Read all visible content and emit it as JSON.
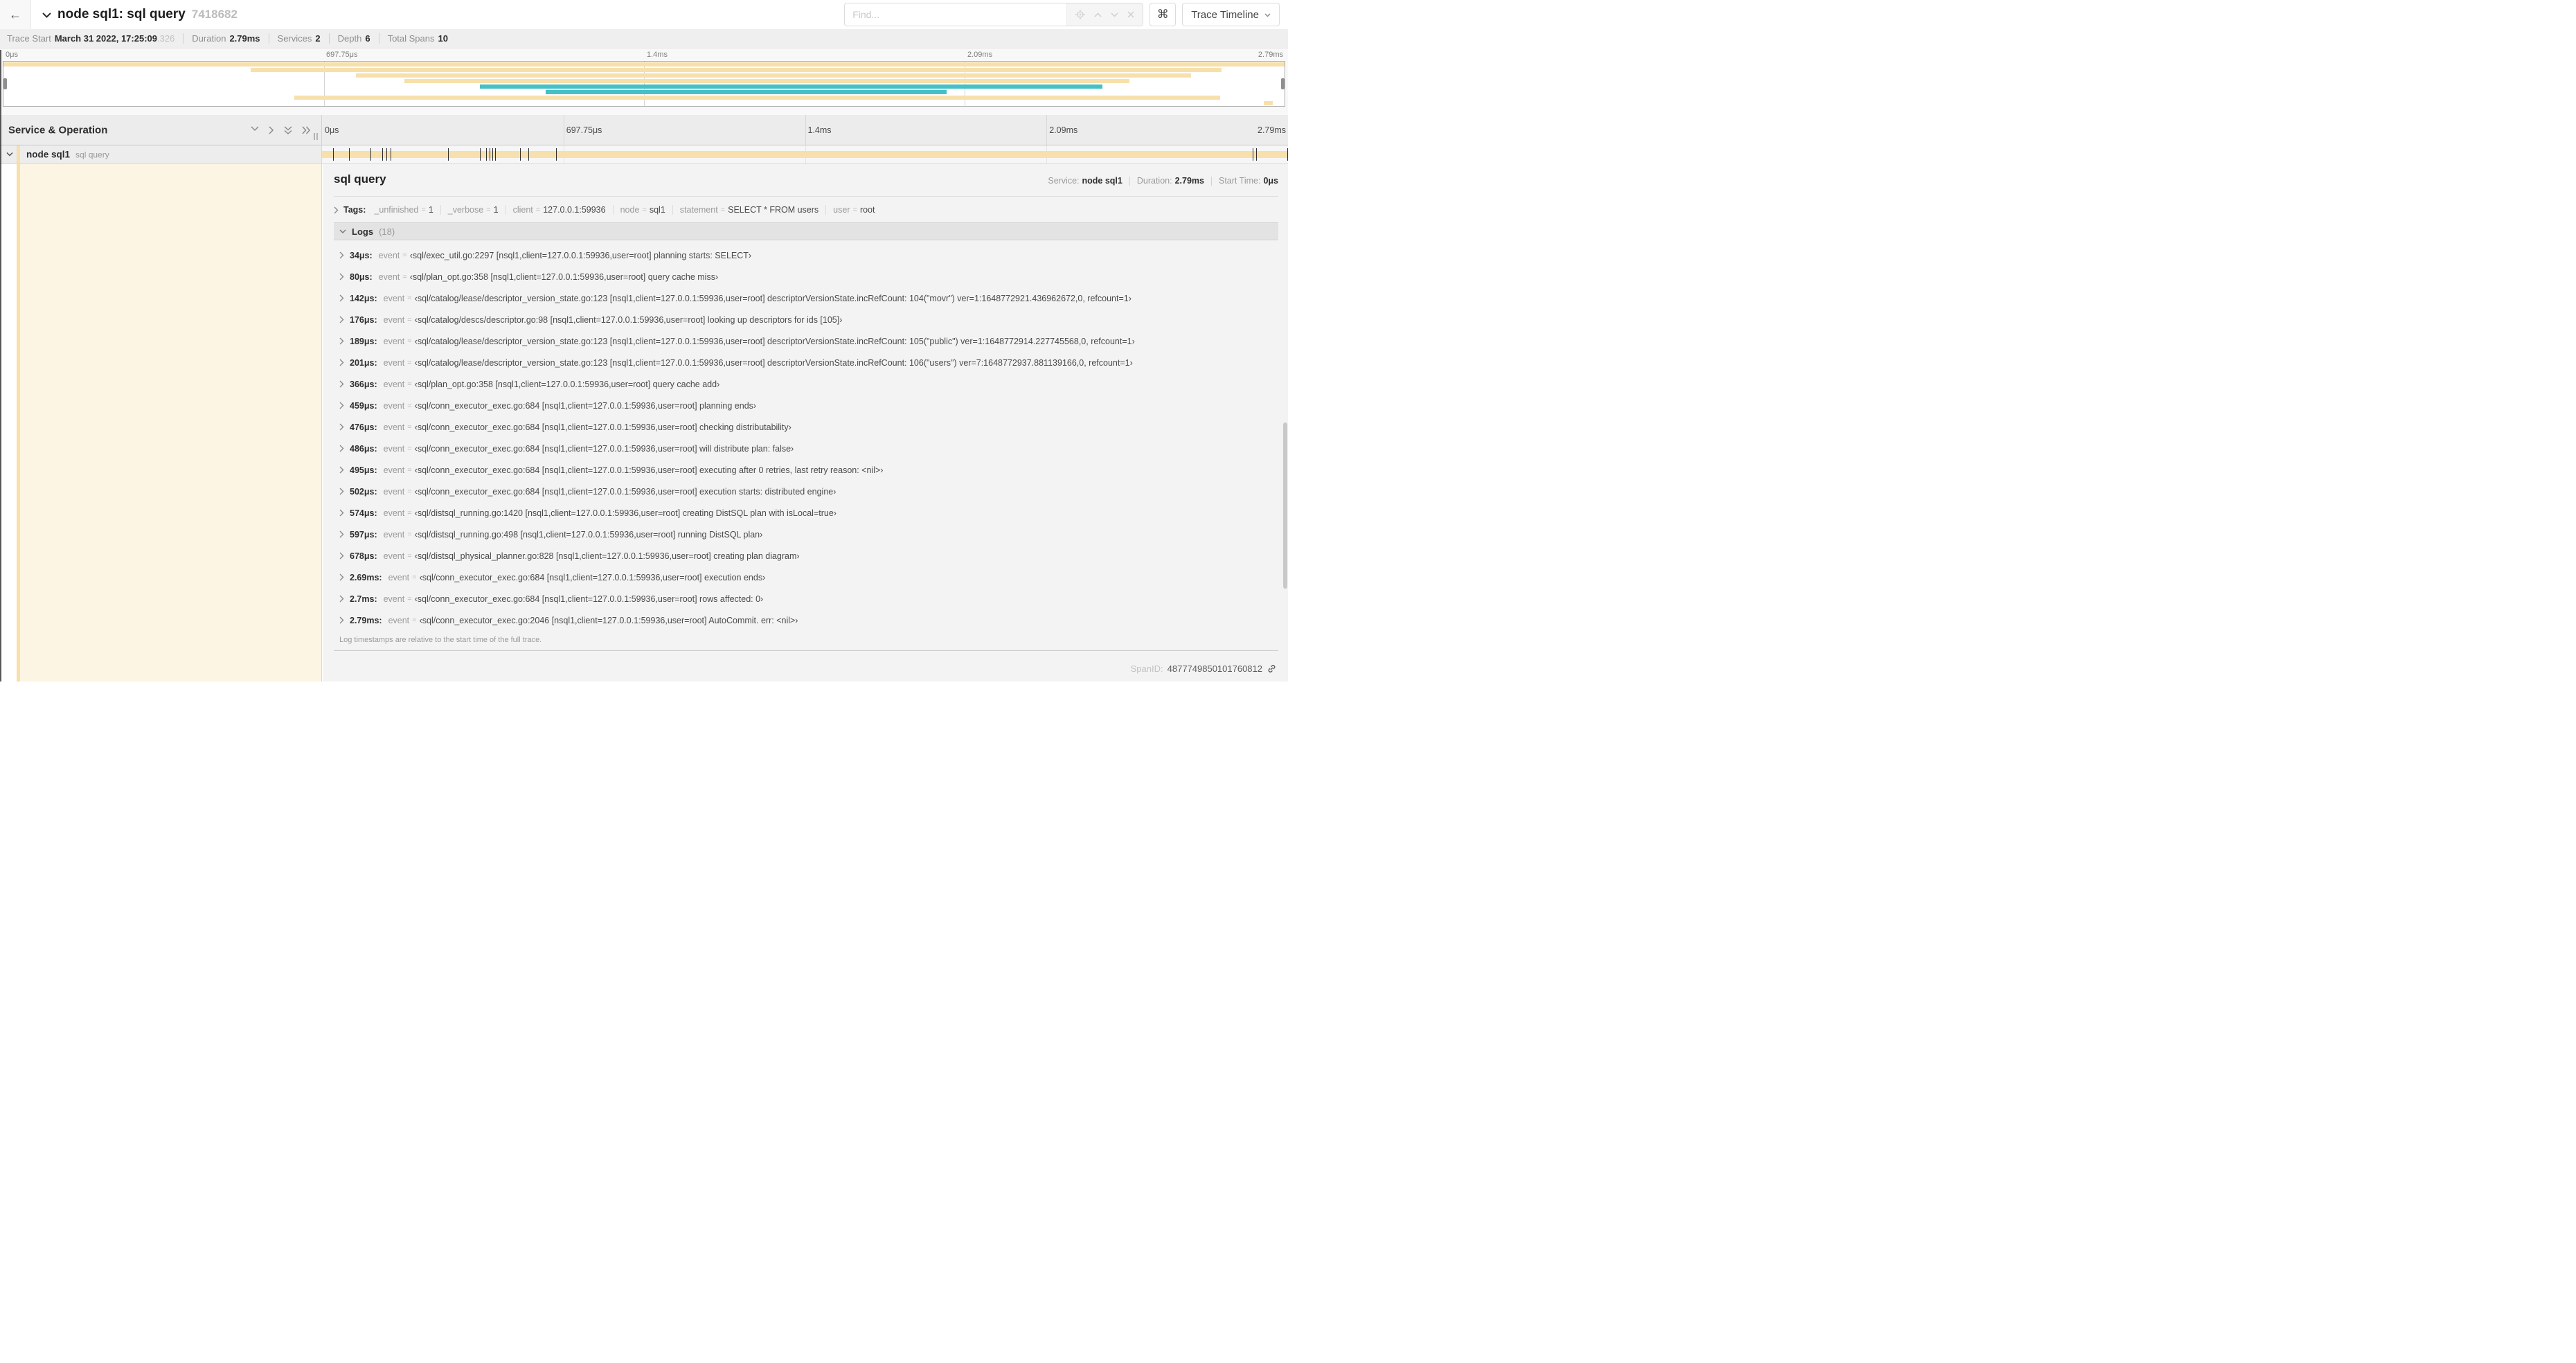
{
  "colors": {
    "span_tan": "#f7e0ab",
    "span_teal": "#44c0c9",
    "detail_left_bg": "#fcf5e3"
  },
  "topbar": {
    "back": "←",
    "title": "node sql1: sql query",
    "trace_id": "7418682",
    "find_placeholder": "Find...",
    "cmd": "⌘",
    "view_button": "Trace Timeline"
  },
  "summary": {
    "items": [
      {
        "label": "Trace Start",
        "value": "March 31 2022, 17:25:09",
        "muted": ".326"
      },
      {
        "label": "Duration",
        "value": "2.79ms"
      },
      {
        "label": "Services",
        "value": "2"
      },
      {
        "label": "Depth",
        "value": "6"
      },
      {
        "label": "Total Spans",
        "value": "10"
      }
    ]
  },
  "timeline": {
    "ticks": [
      {
        "label": "0μs",
        "pct": 0
      },
      {
        "label": "697.75μs",
        "pct": 25
      },
      {
        "label": "1.4ms",
        "pct": 50
      },
      {
        "label": "2.09ms",
        "pct": 75
      },
      {
        "label": "2.79ms",
        "pct": 100
      }
    ]
  },
  "minimap": {
    "rows": [
      {
        "start": 0,
        "end": 100,
        "color": "span_tan"
      },
      {
        "start": 19.3,
        "end": 95.1,
        "color": "span_tan"
      },
      {
        "start": 27.5,
        "end": 92.7,
        "color": "span_tan"
      },
      {
        "start": 31.3,
        "end": 87.9,
        "color": "span_tan"
      },
      {
        "start": 37.2,
        "end": 85.8,
        "color": "span_teal"
      },
      {
        "start": 42.3,
        "end": 73.6,
        "color": "span_teal"
      },
      {
        "start": 22.7,
        "end": 95.0,
        "color": "span_tan"
      },
      {
        "start": 98.4,
        "end": 99.1,
        "color": "span_tan"
      }
    ]
  },
  "grid_header": {
    "left_title": "Service & Operation"
  },
  "span_row": {
    "service": "node sql1",
    "operation": "sql query",
    "marks_pct": [
      1.22,
      2.87,
      5.09,
      6.31,
      6.77,
      7.2,
      13.12,
      16.45,
      17.06,
      17.42,
      17.74,
      18.0,
      20.57,
      21.4,
      24.3,
      96.42,
      96.77,
      100
    ]
  },
  "detail": {
    "title": "sql query",
    "meta": [
      {
        "label": "Service:",
        "value": "node sql1"
      },
      {
        "label": "Duration:",
        "value": "2.79ms"
      },
      {
        "label": "Start Time:",
        "value": "0μs"
      }
    ],
    "tags_label": "Tags:",
    "eq": "=",
    "tags": [
      {
        "key": "_unfinished",
        "value": "1"
      },
      {
        "key": "_verbose",
        "value": "1"
      },
      {
        "key": "client",
        "value": "127.0.0.1:59936"
      },
      {
        "key": "node",
        "value": "sql1"
      },
      {
        "key": "statement",
        "value": "SELECT * FROM users"
      },
      {
        "key": "user",
        "value": "root"
      }
    ],
    "logs_label": "Logs",
    "logs_count": "(18)",
    "log_field": "event",
    "logs": [
      {
        "t": "34μs:",
        "v": "‹sql/exec_util.go:2297 [nsql1,client=127.0.0.1:59936,user=root] planning starts: SELECT›"
      },
      {
        "t": "80μs:",
        "v": "‹sql/plan_opt.go:358 [nsql1,client=127.0.0.1:59936,user=root] query cache miss›"
      },
      {
        "t": "142μs:",
        "v": "‹sql/catalog/lease/descriptor_version_state.go:123 [nsql1,client=127.0.0.1:59936,user=root] descriptorVersionState.incRefCount: 104(\"movr\") ver=1:1648772921.436962672,0, refcount=1›"
      },
      {
        "t": "176μs:",
        "v": "‹sql/catalog/descs/descriptor.go:98 [nsql1,client=127.0.0.1:59936,user=root] looking up descriptors for ids [105]›"
      },
      {
        "t": "189μs:",
        "v": "‹sql/catalog/lease/descriptor_version_state.go:123 [nsql1,client=127.0.0.1:59936,user=root] descriptorVersionState.incRefCount: 105(\"public\") ver=1:1648772914.227745568,0, refcount=1›"
      },
      {
        "t": "201μs:",
        "v": "‹sql/catalog/lease/descriptor_version_state.go:123 [nsql1,client=127.0.0.1:59936,user=root] descriptorVersionState.incRefCount: 106(\"users\") ver=7:1648772937.881139166,0, refcount=1›"
      },
      {
        "t": "366μs:",
        "v": "‹sql/plan_opt.go:358 [nsql1,client=127.0.0.1:59936,user=root] query cache add›"
      },
      {
        "t": "459μs:",
        "v": "‹sql/conn_executor_exec.go:684 [nsql1,client=127.0.0.1:59936,user=root] planning ends›"
      },
      {
        "t": "476μs:",
        "v": "‹sql/conn_executor_exec.go:684 [nsql1,client=127.0.0.1:59936,user=root] checking distributability›"
      },
      {
        "t": "486μs:",
        "v": "‹sql/conn_executor_exec.go:684 [nsql1,client=127.0.0.1:59936,user=root] will distribute plan: false›"
      },
      {
        "t": "495μs:",
        "v": "‹sql/conn_executor_exec.go:684 [nsql1,client=127.0.0.1:59936,user=root] executing after 0 retries, last retry reason: <nil>›"
      },
      {
        "t": "502μs:",
        "v": "‹sql/conn_executor_exec.go:684 [nsql1,client=127.0.0.1:59936,user=root] execution starts: distributed engine›"
      },
      {
        "t": "574μs:",
        "v": "‹sql/distsql_running.go:1420 [nsql1,client=127.0.0.1:59936,user=root] creating DistSQL plan with isLocal=true›"
      },
      {
        "t": "597μs:",
        "v": "‹sql/distsql_running.go:498 [nsql1,client=127.0.0.1:59936,user=root] running DistSQL plan›"
      },
      {
        "t": "678μs:",
        "v": "‹sql/distsql_physical_planner.go:828 [nsql1,client=127.0.0.1:59936,user=root] creating plan diagram›"
      },
      {
        "t": "2.69ms:",
        "v": "‹sql/conn_executor_exec.go:684 [nsql1,client=127.0.0.1:59936,user=root] execution ends›"
      },
      {
        "t": "2.7ms:",
        "v": "‹sql/conn_executor_exec.go:684 [nsql1,client=127.0.0.1:59936,user=root] rows affected: 0›"
      },
      {
        "t": "2.79ms:",
        "v": "‹sql/conn_executor_exec.go:2046 [nsql1,client=127.0.0.1:59936,user=root] AutoCommit. err: <nil>›"
      }
    ],
    "footer_note": "Log timestamps are relative to the start time of the full trace.",
    "spanid_label": "SpanID:",
    "spanid_value": "4877749850101760812"
  }
}
